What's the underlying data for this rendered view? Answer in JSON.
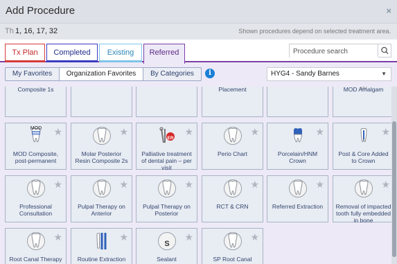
{
  "dialog": {
    "title": "Add Procedure",
    "close_symbol": "×",
    "teeth_label": "Th",
    "teeth_value": "1, 16, 17, 32",
    "note": "Shown procedures depend on selected treatment area."
  },
  "tabs": [
    {
      "label": "Tx Plan"
    },
    {
      "label": "Completed"
    },
    {
      "label": "Existing"
    },
    {
      "label": "Referred"
    }
  ],
  "search": {
    "placeholder": "Procedure search"
  },
  "filters": {
    "my_favorites": "My Favorites",
    "org_favorites": "Organization Favorites",
    "by_categories": "By Categories"
  },
  "info_icon": "i",
  "provider": {
    "selected": "HYG4 - Sandy Barnes"
  },
  "procedures": [
    {
      "name": "Composite 1s",
      "icon": "none"
    },
    {
      "name": "",
      "icon": "none"
    },
    {
      "name": "",
      "icon": "none"
    },
    {
      "name": "Placement",
      "icon": "none"
    },
    {
      "name": "",
      "icon": "none"
    },
    {
      "name": "MOD Amalgam",
      "icon": "tooth-mod-amalgam-icon",
      "badge": "MOD"
    },
    {
      "name": "MOD Composite, post-permanent",
      "icon": "tooth-mod-composite-icon",
      "badge": "MOD"
    },
    {
      "name": "Molar Posterior Resin Composite 2s",
      "icon": "tooth-icon"
    },
    {
      "name": "Palliative treatment of dental pain – per visit",
      "icon": "dental-tools-er-icon",
      "badge": "ER"
    },
    {
      "name": "Perio Chart",
      "icon": "tooth-icon"
    },
    {
      "name": "Porcelain/HNM Crown",
      "icon": "tooth-crown-icon"
    },
    {
      "name": "Post & Core Added to Crown",
      "icon": "tooth-post-icon"
    },
    {
      "name": "Professional Consultation",
      "icon": "tooth-icon"
    },
    {
      "name": "Pulpal Therapy on Anterior",
      "icon": "tooth-icon"
    },
    {
      "name": "Pulpal Therapy on Posterior",
      "icon": "tooth-icon"
    },
    {
      "name": "RCT & CRN",
      "icon": "tooth-icon"
    },
    {
      "name": "Referred Extraction",
      "icon": "tooth-icon"
    },
    {
      "name": "Removal of impacted tooth fully embedded in bone",
      "icon": "tooth-icon"
    },
    {
      "name": "Root Canal Therapy on Molar Tooth",
      "icon": "tooth-icon"
    },
    {
      "name": "Routine Extraction",
      "icon": "tooth-extraction-icon"
    },
    {
      "name": "Sealant",
      "icon": "sealant-icon",
      "badge": "S"
    },
    {
      "name": "SP Root Canal Therapy on Molar Tooth",
      "icon": "tooth-icon"
    }
  ],
  "colors": {
    "tx_plan": "#d73a3a",
    "completed": "#3a3ac0",
    "existing": "#7fc4e8",
    "referred": "#7b3fa8",
    "panel": "#ede9f6"
  }
}
